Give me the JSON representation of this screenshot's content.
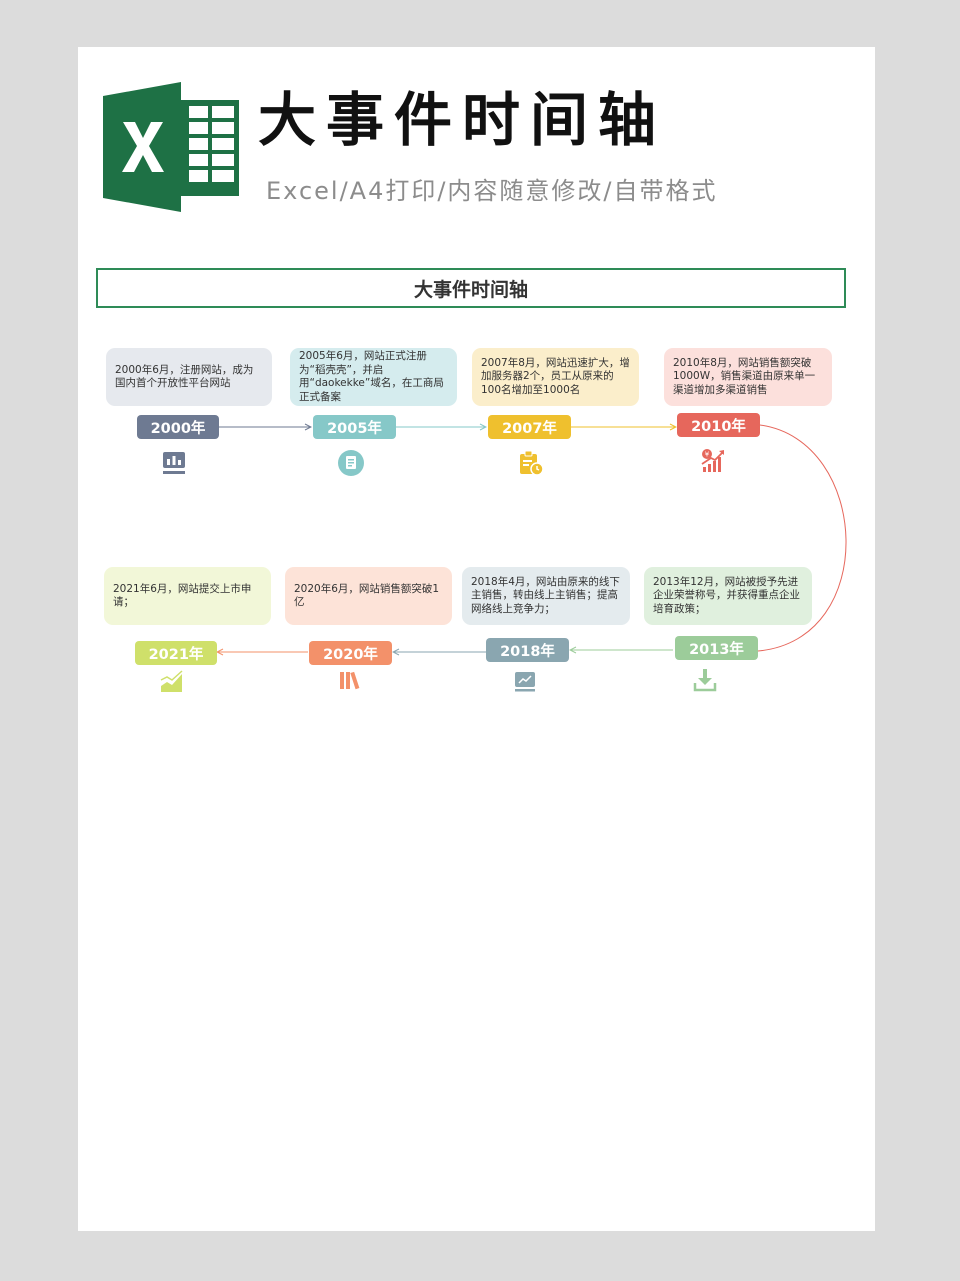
{
  "header": {
    "title": "大事件时间轴",
    "subtitle": "Excel/A4打印/内容随意修改/自带格式"
  },
  "timeline": {
    "title": "大事件时间轴",
    "events": [
      {
        "year": "2000年",
        "text": "2000年6月，注册网站，成为国内首个开放性平台网站",
        "color": "#6e7a92",
        "card_bg": "#e6e9ee",
        "icon": "bar-chart-icon"
      },
      {
        "year": "2005年",
        "text": "2005年6月，网站正式注册为“稻壳壳”，并启用“daokekke”域名，在工商局正式备案",
        "color": "#86c8c8",
        "card_bg": "#d5ecee",
        "icon": "document-icon"
      },
      {
        "year": "2007年",
        "text": "2007年8月，网站迅速扩大，增加服务器2个，员工从原来的100名增加至1000名",
        "color": "#efc02e",
        "card_bg": "#fbeecb",
        "icon": "clipboard-icon"
      },
      {
        "year": "2010年",
        "text": "2010年8月，网站销售额突破1000W，销售渠道由原来单一渠道增加多渠道销售",
        "color": "#e6675c",
        "card_bg": "#fce0dc",
        "icon": "growth-chart-icon"
      },
      {
        "year": "2013年",
        "text": "2013年12月，网站被授予先进企业荣誉称号，并获得重点企业培育政策；",
        "color": "#9ccc9a",
        "card_bg": "#e0f0de",
        "icon": "download-icon"
      },
      {
        "year": "2018年",
        "text": "2018年4月，网站由原来的线下主销售，转由线上主销售；提高网络线上竞争力；",
        "color": "#8aa6b0",
        "card_bg": "#e4ebee",
        "icon": "trend-board-icon"
      },
      {
        "year": "2020年",
        "text": "2020年6月，网站销售额突破1亿",
        "color": "#f3916a",
        "card_bg": "#fde3d8",
        "icon": "books-icon"
      },
      {
        "year": "2021年",
        "text": "2021年6月，网站提交上市申请；",
        "color": "#cfe06a",
        "card_bg": "#f2f7d8",
        "icon": "area-chart-icon"
      }
    ]
  }
}
